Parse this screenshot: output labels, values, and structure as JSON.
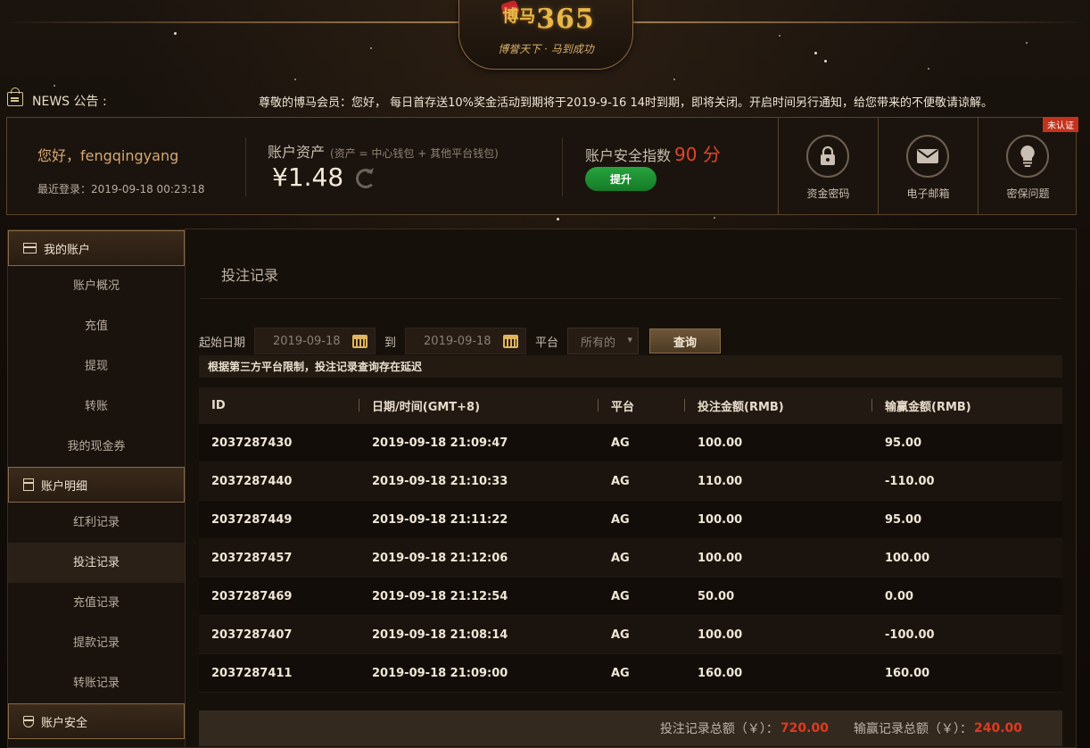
{
  "logo": {
    "brand_digits": "365",
    "brand_char": "博马",
    "slogan": "博誉天下 · 马到成功"
  },
  "news": {
    "label": "NEWS 公告 :",
    "text": "尊敬的博马会员：您好， 每日首存送10%奖金活动到期将于2019-9-16 14时到期，即将关闭。开启时间另行通知，给您带来的不便敬请谅解。"
  },
  "account": {
    "greeting": "您好，fengqingyang",
    "last_login": "最近登录：2019-09-18 00:23:18",
    "asset_title": "账户资产",
    "asset_note": "(资产 = 中心钱包 + 其他平台钱包)",
    "asset_value": "¥1.48",
    "security_title": "账户安全指数",
    "security_score": "90 分",
    "upgrade_label": "提升",
    "cards": [
      {
        "label": "资金密码",
        "icon": "lock-icon"
      },
      {
        "label": "电子邮箱",
        "icon": "envelope-icon"
      },
      {
        "label": "密保问题",
        "icon": "lightbulb-icon"
      }
    ],
    "unverified_badge": "未认证"
  },
  "sidebar": {
    "section1": {
      "title": "我的账户",
      "items": [
        "账户概况",
        "充值",
        "提现",
        "转账",
        "我的现金券"
      ]
    },
    "section2": {
      "title": "账户明细",
      "items": [
        "红利记录",
        "投注记录",
        "充值记录",
        "提款记录",
        "转账记录"
      ],
      "active_index": 1
    },
    "section3": {
      "title": "账户安全"
    }
  },
  "main": {
    "title": "投注记录",
    "filters": {
      "start_label": "起始日期",
      "start_date": "2019-09-18",
      "to_label": "到",
      "end_date": "2019-09-18",
      "platform_label": "平台",
      "platform_value": "所有的",
      "query_label": "查询"
    },
    "notice": "根据第三方平台限制，投注记录查询存在延迟",
    "table": {
      "headers": [
        "ID",
        "日期/时间(GMT+8)",
        "平台",
        "投注金额(RMB)",
        "输赢金额(RMB)"
      ],
      "rows": [
        [
          "2037287430",
          "2019-09-18 21:09:47",
          "AG",
          "100.00",
          "95.00"
        ],
        [
          "2037287440",
          "2019-09-18 21:10:33",
          "AG",
          "110.00",
          "-110.00"
        ],
        [
          "2037287449",
          "2019-09-18 21:11:22",
          "AG",
          "100.00",
          "95.00"
        ],
        [
          "2037287457",
          "2019-09-18 21:12:06",
          "AG",
          "100.00",
          "100.00"
        ],
        [
          "2037287469",
          "2019-09-18 21:12:54",
          "AG",
          "50.00",
          "0.00"
        ],
        [
          "2037287407",
          "2019-09-18 21:08:14",
          "AG",
          "100.00",
          "-100.00"
        ],
        [
          "2037287411",
          "2019-09-18 21:09:00",
          "AG",
          "160.00",
          "160.00"
        ]
      ]
    },
    "totals": {
      "bet_label": "投注记录总额（￥）：",
      "bet_value": "720.00",
      "win_label": "输赢记录总额（￥）：",
      "win_value": "240.00"
    }
  },
  "colors": {
    "accent_gold": "#d6a874",
    "score_red": "#e0462c",
    "upgrade_green": "#1f9135",
    "total_red": "#e03a1f"
  }
}
